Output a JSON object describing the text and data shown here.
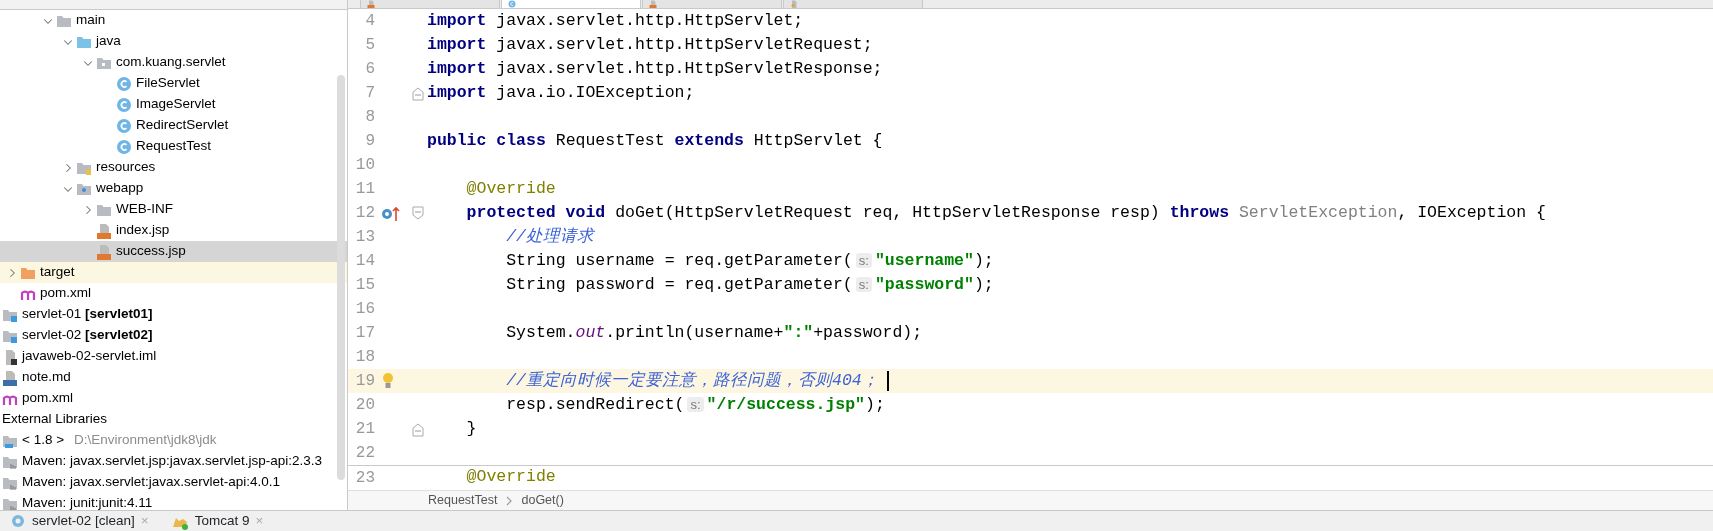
{
  "editor_tabs": [
    {
      "kind": "jsp",
      "selected": false
    },
    {
      "kind": "class",
      "selected": true
    },
    {
      "kind": "jsp",
      "selected": false
    },
    {
      "kind": "xml",
      "selected": false
    }
  ],
  "project_tree": {
    "scrolled_subtree": [
      {
        "label": "main",
        "kind": "folder",
        "expanded": true,
        "selected": false,
        "children": [
          {
            "label": "java",
            "kind": "source-folder",
            "expanded": true,
            "selected": false,
            "children": [
              {
                "label": "com.kuang.servlet",
                "kind": "package",
                "expanded": true,
                "selected": false,
                "children": [
                  {
                    "label": "FileServlet",
                    "kind": "class",
                    "selected": false
                  },
                  {
                    "label": "ImageServlet",
                    "kind": "class",
                    "selected": false
                  },
                  {
                    "label": "RedirectServlet",
                    "kind": "class",
                    "selected": false
                  },
                  {
                    "label": "RequestTest",
                    "kind": "class",
                    "selected": false
                  }
                ]
              }
            ]
          },
          {
            "label": "resources",
            "kind": "resources-folder",
            "expanded": false,
            "selected": false
          },
          {
            "label": "webapp",
            "kind": "web-folder",
            "expanded": true,
            "selected": false,
            "children": [
              {
                "label": "WEB-INF",
                "kind": "folder",
                "expanded": false,
                "selected": false
              },
              {
                "label": "index.jsp",
                "kind": "jsp",
                "selected": false
              },
              {
                "label": "success.jsp",
                "kind": "jsp",
                "selected": true
              }
            ]
          }
        ]
      }
    ],
    "module_items": [
      {
        "label": "target",
        "kind": "excluded-folder",
        "expanded": false,
        "selected": false
      },
      {
        "label": "pom.xml",
        "kind": "maven",
        "selected": false
      }
    ],
    "root_items": [
      {
        "label": "servlet-01 **[servlet01]**",
        "kind": "module",
        "selected": false
      },
      {
        "label": "servlet-02 **[servlet02]**",
        "kind": "module",
        "selected": false
      },
      {
        "label": "javaweb-02-servlet.iml",
        "kind": "iml",
        "selected": false
      },
      {
        "label": "note.md",
        "kind": "markdown",
        "selected": false
      },
      {
        "label": "pom.xml",
        "kind": "maven",
        "selected": false
      },
      {
        "label": "External Libraries",
        "kind": "libraries",
        "selected": false
      },
      {
        "label": "< 1.8 >",
        "detail": "D:\\Environment\\jdk8\\jdk",
        "kind": "sdk",
        "selected": false
      },
      {
        "label": "Maven: javax.servlet.jsp:javax.servlet.jsp-api:2.3.3",
        "kind": "library",
        "selected": false
      },
      {
        "label": "Maven: javax.servlet:javax.servlet-api:4.0.1",
        "kind": "library",
        "selected": false
      },
      {
        "label": "Maven: junit:junit:4.11",
        "kind": "library",
        "selected": false
      }
    ]
  },
  "code_lines": [
    {
      "number": "4",
      "current": false,
      "tokens": [
        {
          "kind": "keyword",
          "text": "import"
        },
        {
          "kind": "plain",
          "text": " javax.servlet.http.HttpServlet;"
        }
      ]
    },
    {
      "number": "5",
      "current": false,
      "tokens": [
        {
          "kind": "keyword",
          "text": "import"
        },
        {
          "kind": "plain",
          "text": " javax.servlet.http.HttpServletRequest;"
        }
      ]
    },
    {
      "number": "6",
      "current": false,
      "tokens": [
        {
          "kind": "keyword",
          "text": "import"
        },
        {
          "kind": "plain",
          "text": " javax.servlet.http.HttpServletResponse;"
        }
      ]
    },
    {
      "number": "7",
      "current": false,
      "gutter_icons": [
        {
          "kind": "fold-end"
        }
      ],
      "tokens": [
        {
          "kind": "keyword",
          "text": "import"
        },
        {
          "kind": "plain",
          "text": " java.io.IOException;"
        }
      ]
    },
    {
      "number": "8",
      "current": false
    },
    {
      "number": "9",
      "current": false,
      "tokens": [
        {
          "kind": "keyword",
          "text": "public class"
        },
        {
          "kind": "plain",
          "text": " RequestTest "
        },
        {
          "kind": "keyword",
          "text": "extends"
        },
        {
          "kind": "plain",
          "text": " HttpServlet {"
        }
      ]
    },
    {
      "number": "10",
      "current": false
    },
    {
      "number": "11",
      "current": false,
      "tokens": [
        {
          "kind": "annotation",
          "text": "    @Override"
        }
      ]
    },
    {
      "number": "12",
      "current": false,
      "gutter_icons": [
        {
          "kind": "override"
        },
        {
          "kind": "fold-start"
        }
      ],
      "tokens": [
        {
          "kind": "keyword",
          "text": "    protected void"
        },
        {
          "kind": "plain",
          "text": " doGet(HttpServletRequest req, HttpServletResponse resp) "
        },
        {
          "kind": "keyword",
          "text": "throws"
        },
        {
          "kind": "muted",
          "text": " ServletException"
        },
        {
          "kind": "plain",
          "text": ", IOException {"
        }
      ]
    },
    {
      "number": "13",
      "current": false,
      "tokens": [
        {
          "kind": "comment",
          "text": "        //处理请求"
        }
      ]
    },
    {
      "number": "14",
      "current": false,
      "tokens": [
        {
          "kind": "plain",
          "text": "        String username = req.getParameter("
        },
        {
          "kind": "hint",
          "text": "s:"
        },
        {
          "kind": "string",
          "text": "\"username\""
        },
        {
          "kind": "plain",
          "text": ");"
        }
      ]
    },
    {
      "number": "15",
      "current": false,
      "tokens": [
        {
          "kind": "plain",
          "text": "        String password = req.getParameter("
        },
        {
          "kind": "hint",
          "text": "s:"
        },
        {
          "kind": "string",
          "text": "\"password\""
        },
        {
          "kind": "plain",
          "text": ");"
        }
      ]
    },
    {
      "number": "16",
      "current": false
    },
    {
      "number": "17",
      "current": false,
      "tokens": [
        {
          "kind": "plain",
          "text": "        System."
        },
        {
          "kind": "static",
          "text": "out"
        },
        {
          "kind": "plain",
          "text": ".println(username+"
        },
        {
          "kind": "string",
          "text": "\":\""
        },
        {
          "kind": "plain",
          "text": "+password);"
        }
      ]
    },
    {
      "number": "18",
      "current": false
    },
    {
      "number": "19",
      "current": true,
      "gutter_icons": [
        {
          "kind": "bulb"
        }
      ],
      "tokens": [
        {
          "kind": "comment",
          "text": "        //重定向时候一定要注意，路径问题，否则404；"
        }
      ]
    },
    {
      "number": "20",
      "current": false,
      "tokens": [
        {
          "kind": "plain",
          "text": "        resp.sendRedirect("
        },
        {
          "kind": "hint",
          "text": "s:"
        },
        {
          "kind": "string",
          "text": "\"/r/success.jsp\""
        },
        {
          "kind": "plain",
          "text": ");"
        }
      ]
    },
    {
      "number": "21",
      "current": false,
      "gutter_icons": [
        {
          "kind": "fold-end"
        }
      ],
      "tokens": [
        {
          "kind": "plain",
          "text": "    }"
        }
      ]
    },
    {
      "number": "22",
      "current": false
    },
    {
      "number": "23",
      "current": false,
      "separator_above": true,
      "tokens": [
        {
          "kind": "annotation",
          "text": "    @Override"
        }
      ]
    }
  ],
  "breadcrumbs": [
    "RequestTest",
    "doGet()"
  ],
  "run_tabs": [
    {
      "label": "servlet-02 [clean]",
      "kind": "maven-run",
      "close": "×"
    },
    {
      "label": "Tomcat 9",
      "kind": "tomcat",
      "close": "×"
    }
  ]
}
